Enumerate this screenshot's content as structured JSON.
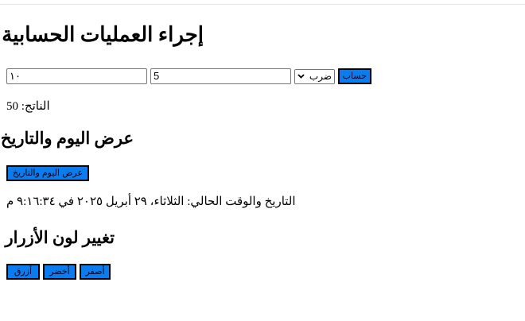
{
  "math": {
    "title": "إجراء العمليات الحسابية",
    "first_value": "١٠",
    "second_value": "5",
    "operation_selected": "ضرب",
    "calc_label": "حساب",
    "result_label": "الناتج:",
    "result_value": "50"
  },
  "datetime": {
    "title": "عرض اليوم والتاريخ",
    "button_label": "عرض اليوم والتاريخ",
    "text": "التاريخ والوقت الحالي: الثلاثاء، ٢٩ أبريل ٢٠٢٥ في ٩:١٦:٣٤ م"
  },
  "colors": {
    "title": "تغيير لون الأزرار",
    "buttons": [
      {
        "label": "أصفر"
      },
      {
        "label": "أخضر"
      },
      {
        "label": "أزرق"
      }
    ],
    "button_bg": "#0a7cf0",
    "button_border": "#000000"
  }
}
